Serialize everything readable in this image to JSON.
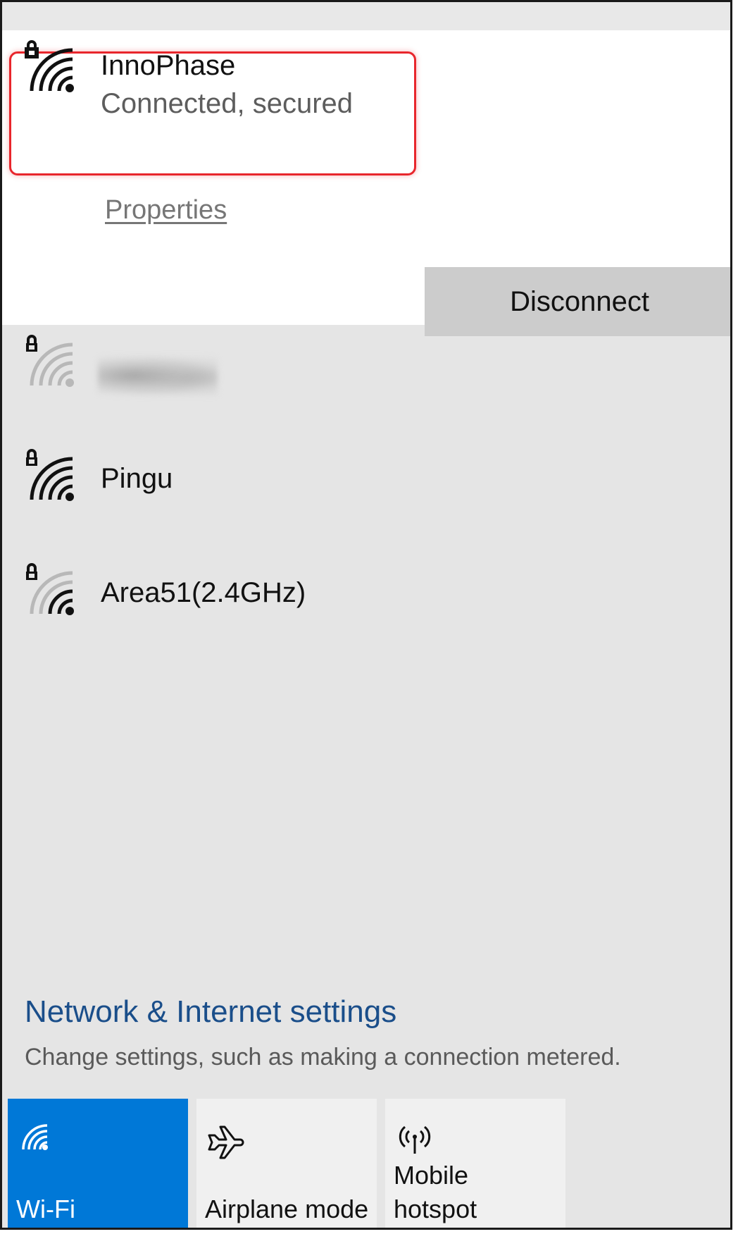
{
  "connected_network": {
    "name": "InnoPhase",
    "status": "Connected, secured",
    "properties_label": "Properties",
    "disconnect_label": "Disconnect",
    "icon": "wifi-secured-icon"
  },
  "networks": [
    {
      "name": "",
      "blurred": true,
      "icon": "wifi-secured-icon",
      "signal_bars": 1
    },
    {
      "name": "Pingu",
      "icon": "wifi-secured-icon",
      "signal_bars": 4
    },
    {
      "name": "Area51(2.4GHz)",
      "icon": "wifi-secured-icon",
      "signal_bars": 2
    }
  ],
  "settings": {
    "title": "Network & Internet settings",
    "description": "Change settings, such as making a connection metered."
  },
  "quick_actions": [
    {
      "label": "Wi-Fi",
      "icon": "wifi-icon",
      "active": true
    },
    {
      "label": "Airplane mode",
      "icon": "airplane-icon",
      "active": false
    },
    {
      "label_line1": "Mobile",
      "label_line2": "hotspot",
      "icon": "hotspot-icon",
      "active": false
    }
  ],
  "colors": {
    "accent": "#0078d7",
    "highlight": "#e8262c",
    "link": "#1a4e8a",
    "panel_bg": "#e5e5e5"
  }
}
